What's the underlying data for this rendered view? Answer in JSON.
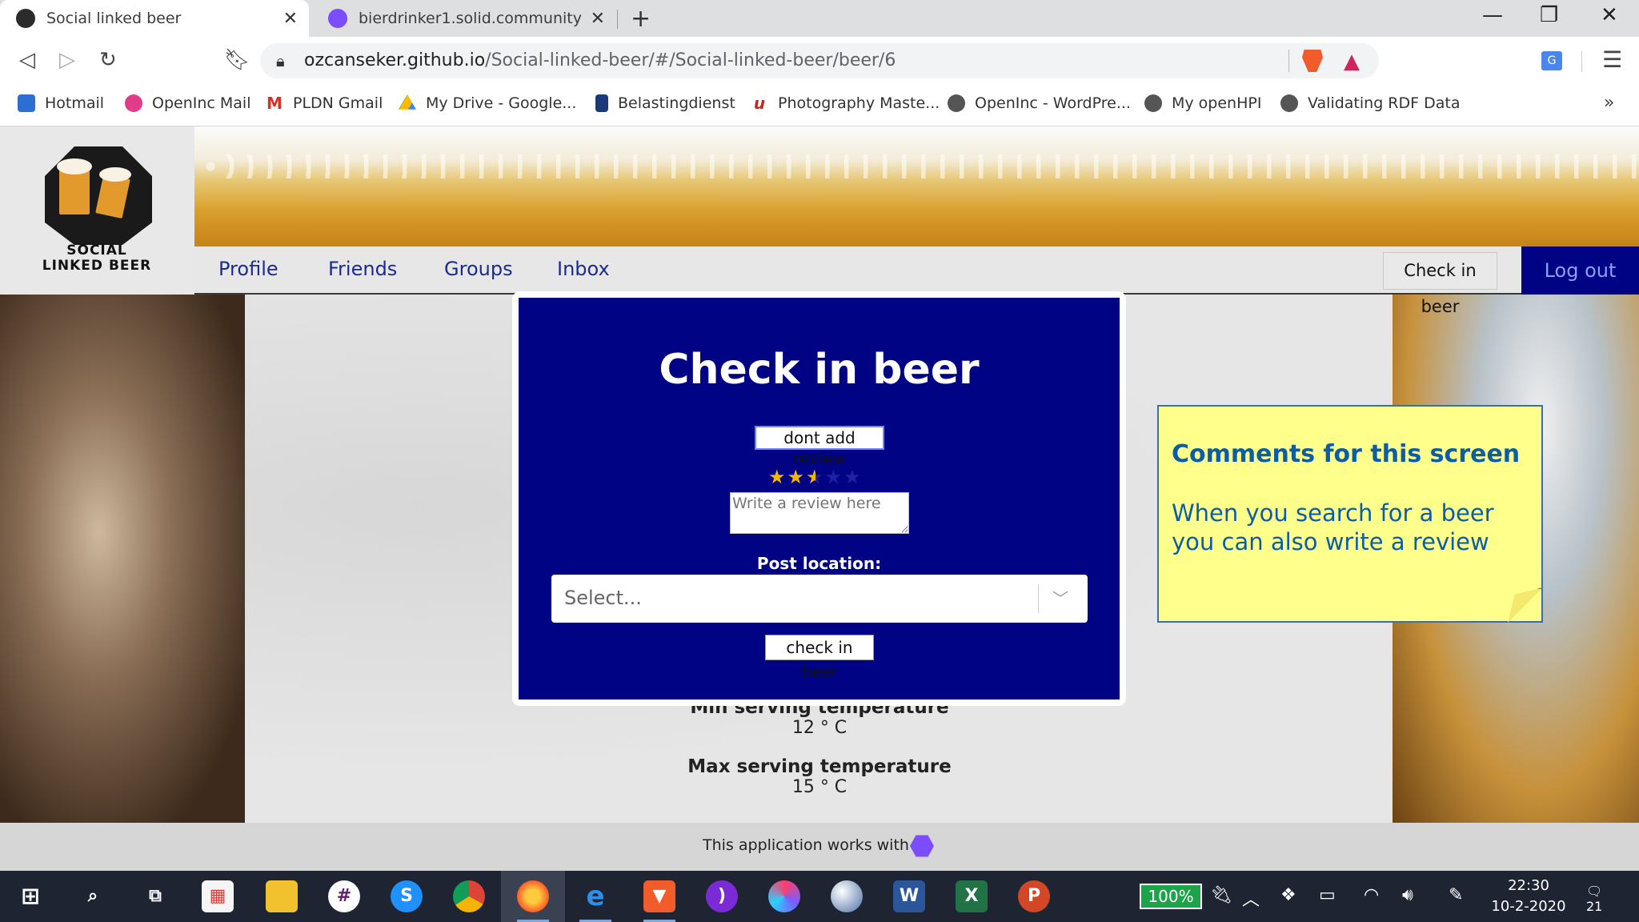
{
  "browser": {
    "tabs": [
      {
        "title": "Social linked beer",
        "active": true
      },
      {
        "title": "bierdrinker1.solid.community",
        "active": false
      }
    ],
    "new_tab": "+",
    "window_controls": {
      "minimize": "—",
      "restore": "❐",
      "close": "✕"
    },
    "url_host": "ozcanseker.github.io",
    "url_path": "/Social-linked-beer/#/Social-linked-beer/beer/6",
    "bookmarks": [
      "Hotmail",
      "OpenInc Mail",
      "PLDN Gmail",
      "My Drive - Google...",
      "Belastingdienst",
      "Photography Maste...",
      "OpenInc - WordPre...",
      "My openHPI",
      "Validating RDF Data"
    ],
    "bookmarks_more": "»"
  },
  "site": {
    "logo_text_line1": "SOCIAL",
    "logo_text_line2": "LINKED BEER",
    "nav": [
      "Profile",
      "Friends",
      "Groups",
      "Inbox"
    ],
    "checkin_button": "Check in beer",
    "logout_button": "Log out",
    "beer": {
      "min_temp_label": "Min serving temperature",
      "min_temp_value": "12 ° C",
      "max_temp_label": "Max serving temperature",
      "max_temp_value": "15 ° C"
    },
    "footer_text": "This application works with"
  },
  "modal": {
    "title": "Check in beer",
    "no_review_button": "dont add review",
    "rating": 2.5,
    "rating_max": 5,
    "review_placeholder": "Write a review here",
    "post_location_label": "Post location:",
    "location_placeholder": "Select...",
    "submit_button": "check in beer"
  },
  "sticky_note": {
    "title": "Comments for this screen",
    "body": "When you search for a beer you can also write a review"
  },
  "taskbar": {
    "battery": "100%",
    "time": "22:30",
    "date": "10-2-2020",
    "notifications": "21"
  },
  "colors": {
    "brand_blue": "#000384",
    "note_yellow": "#ffff8c",
    "note_text": "#0b5da6",
    "star": "#f2b705"
  }
}
